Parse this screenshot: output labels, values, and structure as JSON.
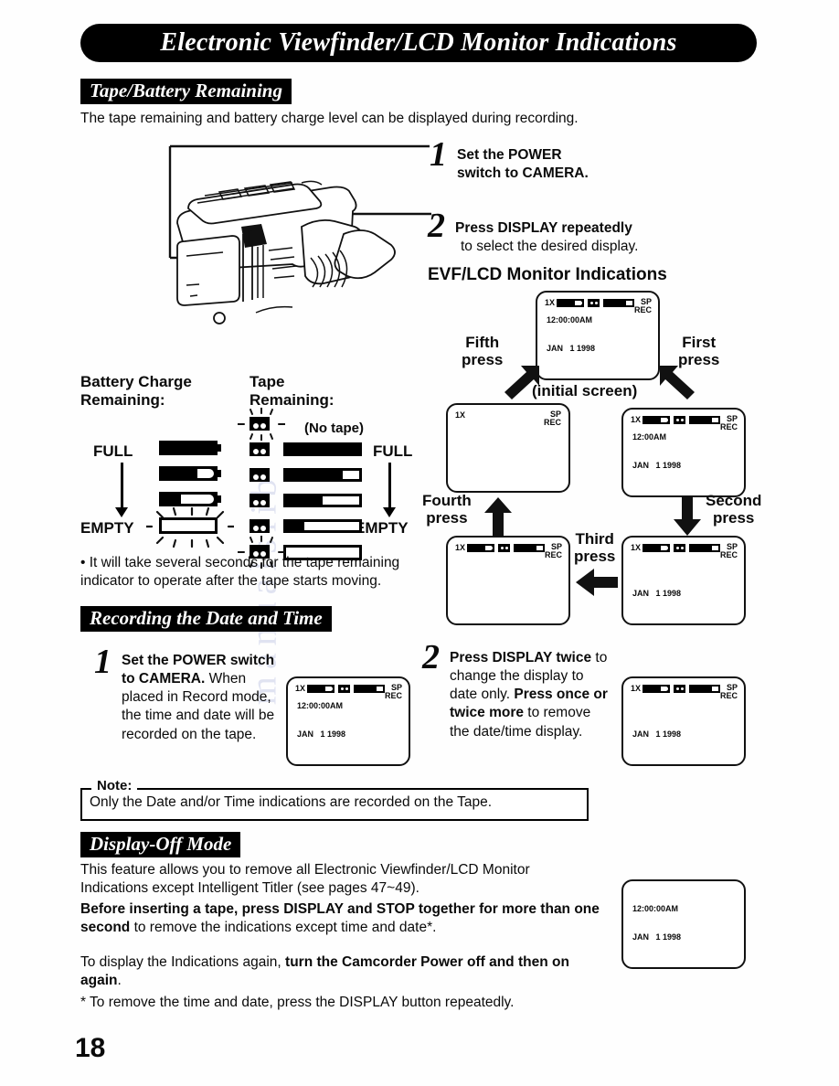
{
  "page": {
    "number": "18",
    "title": "Electronic Viewfinder/LCD Monitor Indications"
  },
  "sections": {
    "tape_battery": {
      "heading": "Tape/Battery Remaining",
      "intro": "The tape remaining and battery charge level can be displayed during recording.",
      "step1": {
        "number": "1",
        "line1": "Set the POWER",
        "line2": "switch to CAMERA."
      },
      "step2": {
        "number": "2",
        "line1": "Press DISPLAY repeatedly",
        "line2": "to select the desired display."
      },
      "evf_heading": "EVF/LCD Monitor Indications",
      "initial_caption": "(initial screen)",
      "press_labels": {
        "first": "First\npress",
        "second": "Second\npress",
        "third": "Third\npress",
        "fourth": "Fourth\npress",
        "fifth": "Fifth\npress"
      },
      "bullet": "• It will take several seconds for the tape remaining indicator to operate after the tape starts moving."
    },
    "remaining_diagram": {
      "battery_label": "Battery Charge\nRemaining:",
      "tape_label": "Tape\nRemaining:",
      "no_tape": "(No tape)",
      "full_left": "FULL",
      "empty_left": "EMPTY",
      "full_right": "FULL",
      "empty_right": "EMPTY",
      "battery_levels": [
        100,
        72,
        45,
        0
      ],
      "tape_levels": [
        100,
        78,
        52,
        26,
        0
      ]
    },
    "recording_date_time": {
      "heading": "Recording the Date and Time",
      "step1": {
        "number": "1",
        "bold": "Set the POWER switch to CAMERA.",
        "rest": " When placed in Record mode, the time and date will be recorded on the tape."
      },
      "step2": {
        "number": "2",
        "part1_bold": "Press DISPLAY twice",
        "part1_rest": " to change the display to date only. ",
        "part2_bold": "Press once or twice more",
        "part2_rest": " to remove the date/time display."
      }
    },
    "note": {
      "label": "Note:",
      "text": "Only the Date and/or Time indications are recorded on the Tape."
    },
    "display_off": {
      "heading": "Display-Off Mode",
      "p1": "This feature allows you to remove all Electronic Viewfinder/LCD Monitor Indications except Intelligent Titler (see pages 47~49).",
      "p2_bold_a": "Before inserting a tape, press DISPLAY and STOP together for more than one second",
      "p2_rest": " to remove the indications except time and date*.",
      "p3_lead": "To display the Indications again, ",
      "p3_bold": "turn the Camcorder Power off and then on again",
      "p3_tail": ".",
      "p4": "* To remove the time and date, press the DISPLAY button repeatedly."
    }
  },
  "lcd_screens": {
    "initial": {
      "zoom": "1X",
      "mode_line1": "SP",
      "mode_line2": "REC",
      "time": "12:00:00AM",
      "date": "JAN   1 1998",
      "show_meters": true
    },
    "first": {
      "zoom": "1X",
      "mode_line1": "SP",
      "mode_line2": "REC",
      "time": "12:00AM",
      "date": "JAN   1 1998",
      "show_meters": true
    },
    "second": {
      "zoom": "1X",
      "mode_line1": "SP",
      "mode_line2": "REC",
      "time": "",
      "date": "JAN   1 1998",
      "show_meters": true
    },
    "third": {
      "zoom": "1X",
      "mode_line1": "SP",
      "mode_line2": "REC",
      "time": "",
      "date": "",
      "show_meters": true
    },
    "fourth": {
      "zoom": "1X",
      "mode_line1": "SP",
      "mode_line2": "REC",
      "time": "",
      "date": "",
      "show_meters": false
    },
    "rec1": {
      "zoom": "1X",
      "mode_line1": "SP",
      "mode_line2": "REC",
      "time": "12:00:00AM",
      "date": "JAN   1 1998",
      "show_meters": true
    },
    "rec2": {
      "zoom": "1X",
      "mode_line1": "SP",
      "mode_line2": "REC",
      "time": "",
      "date": "JAN   1 1998",
      "show_meters": true
    },
    "displayoff": {
      "zoom": "",
      "mode_line1": "",
      "mode_line2": "",
      "time": "12:00:00AM",
      "date": "JAN   1 1998",
      "show_meters": false
    }
  },
  "colors": {
    "ink": "#0a0a0a",
    "paper": "#fefefe",
    "watermark": "#c9cde8"
  }
}
